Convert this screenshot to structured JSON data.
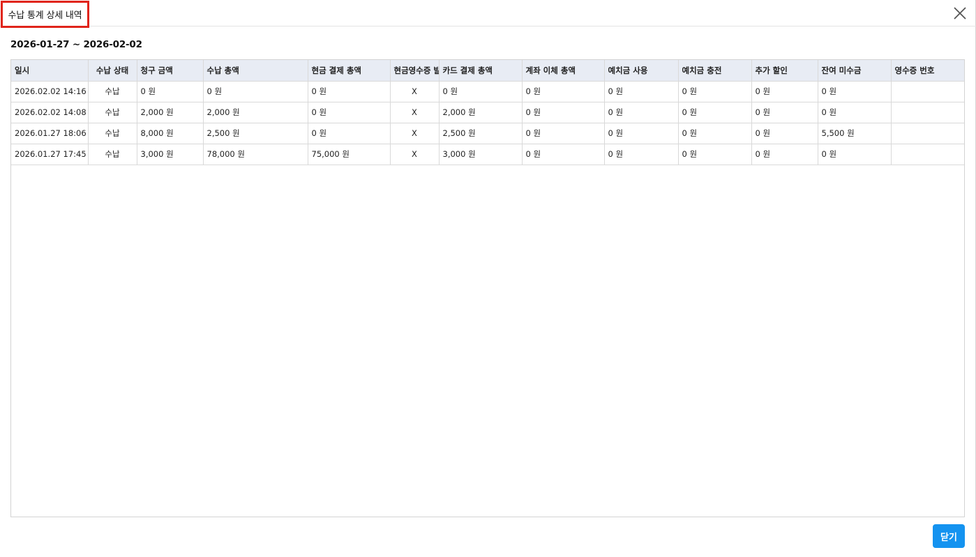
{
  "dialog": {
    "title": "수납 통계 상세 내역",
    "date_range": "2026-01-27 ~ 2026-02-02",
    "close_icon": "close-icon",
    "close_button_label": "닫기"
  },
  "table": {
    "columns": [
      "일시",
      "수납 상태",
      "청구 금액",
      "수납 총액",
      "현금 결제 총액",
      "현금영수증 발",
      "카드 결제 총액",
      "계좌 이체 총액",
      "예치금 사용",
      "예치금 충전",
      "추가 할인",
      "잔여 미수금",
      "영수증 번호"
    ],
    "rows": [
      [
        "2026.02.02 14:16",
        "수납",
        "0 원",
        "0 원",
        "0 원",
        "X",
        "0 원",
        "0 원",
        "0 원",
        "0 원",
        "0 원",
        "0 원",
        ""
      ],
      [
        "2026.02.02 14:08",
        "수납",
        "2,000 원",
        "2,000 원",
        "0 원",
        "X",
        "2,000 원",
        "0 원",
        "0 원",
        "0 원",
        "0 원",
        "0 원",
        ""
      ],
      [
        "2026.01.27 18:06",
        "수납",
        "8,000 원",
        "2,500 원",
        "0 원",
        "X",
        "2,500 원",
        "0 원",
        "0 원",
        "0 원",
        "0 원",
        "5,500 원",
        ""
      ],
      [
        "2026.01.27 17:45",
        "수납",
        "3,000 원",
        "78,000 원",
        "75,000 원",
        "X",
        "3,000 원",
        "0 원",
        "0 원",
        "0 원",
        "0 원",
        "0 원",
        ""
      ]
    ]
  }
}
